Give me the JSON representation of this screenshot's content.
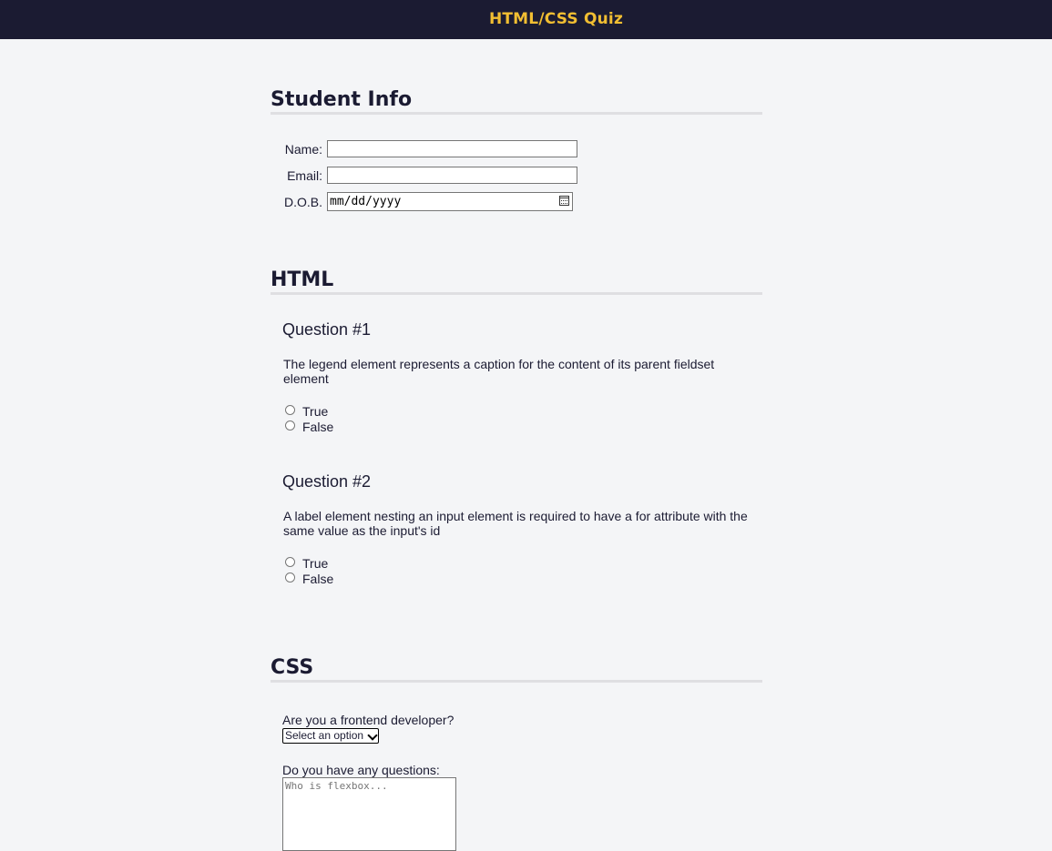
{
  "header": {
    "title": "HTML/CSS Quiz"
  },
  "student_info": {
    "heading": "Student Info",
    "name_label": "Name:",
    "email_label": "Email:",
    "dob_label": "D.O.B.",
    "dob_placeholder": "mm/dd/yyyy"
  },
  "html_section": {
    "heading": "HTML",
    "questions": [
      {
        "title": "Question #1",
        "text": "The legend element represents a caption for the content of its parent fieldset element",
        "options": [
          "True",
          "False"
        ]
      },
      {
        "title": "Question #2",
        "text": "A label element nesting an input element is required to have a for attribute with the same value as the input's id",
        "options": [
          "True",
          "False"
        ]
      }
    ]
  },
  "css_section": {
    "heading": "CSS",
    "frontend_label": "Are you a frontend developer?",
    "select_value": "Select an option",
    "questions_label": "Do you have any questions:",
    "textarea_placeholder": "Who is flexbox..."
  }
}
